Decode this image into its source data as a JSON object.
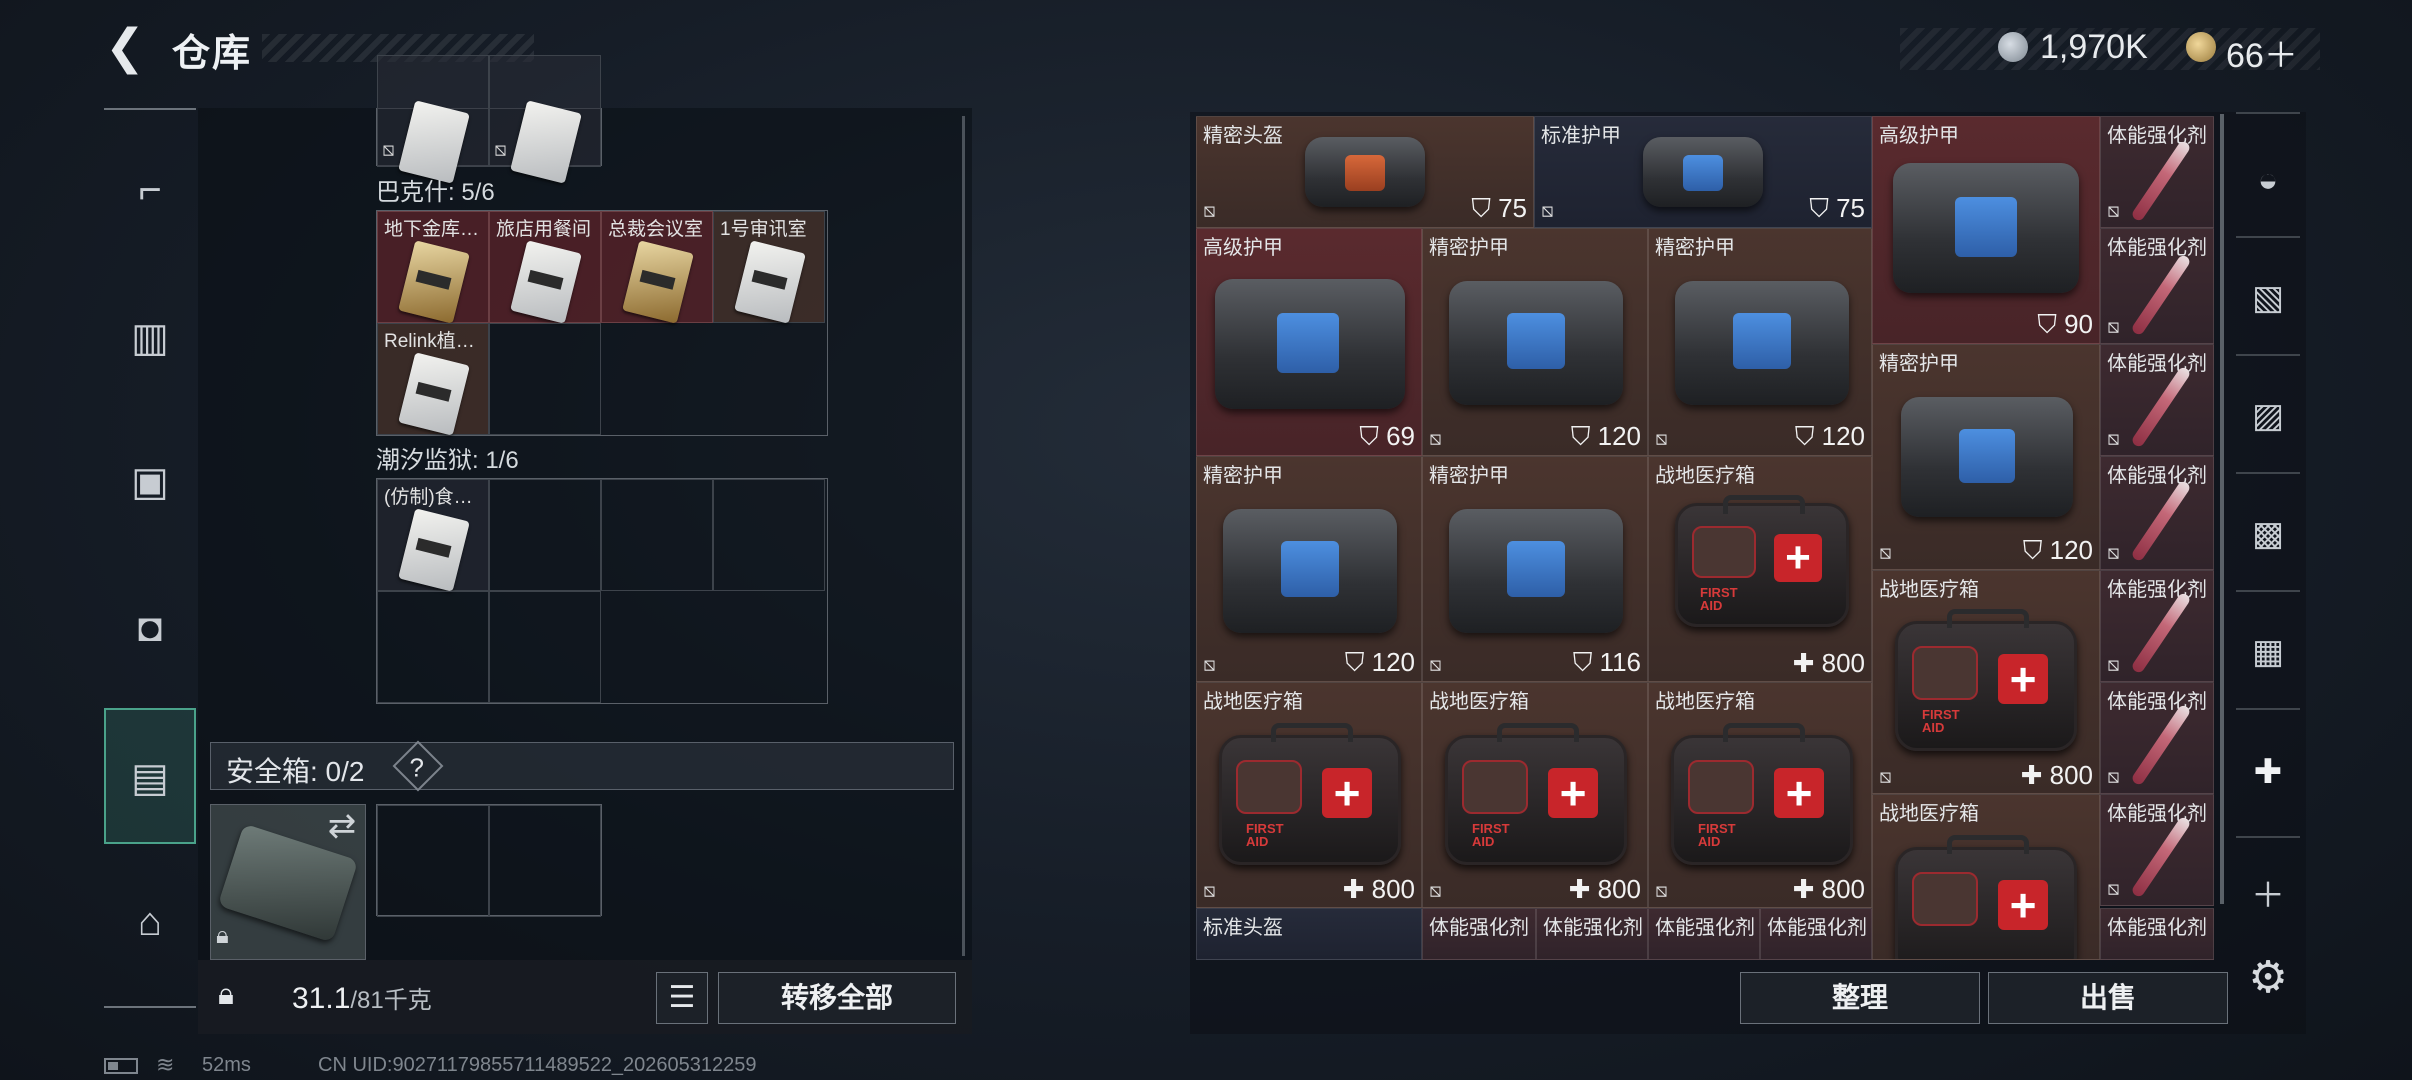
{
  "header": {
    "back_label": "<",
    "title": "仓库",
    "currency1": "1,970K",
    "currency2": "66＋"
  },
  "sidebar_categories": [
    {
      "icon": "pistol-icon"
    },
    {
      "icon": "vest-icon"
    },
    {
      "icon": "backpack-icon"
    },
    {
      "icon": "bag-icon"
    },
    {
      "icon": "safe-case-icon",
      "selected": true
    },
    {
      "icon": "toolbox-icon"
    }
  ],
  "storage": {
    "group1_label": "巴克什: 5/6",
    "group1_items": [
      "地下金库…",
      "旅店用餐间",
      "总裁会议室",
      "1号审讯室",
      "Relink植…"
    ],
    "group2_label": "潮汐监狱: 1/6",
    "group2_items": [
      "(仿制)食…"
    ]
  },
  "safe_box": {
    "label": "安全箱: 0/2",
    "help": "?"
  },
  "weight": {
    "current": "31.1",
    "max": "/81千克"
  },
  "buttons": {
    "list_icon": "☰",
    "transfer_all": "转移全部",
    "sort": "整理",
    "sell": "出售"
  },
  "inventory": [
    {
      "label": "精密头盔",
      "value": "75"
    },
    {
      "label": "标准护甲",
      "value": "75"
    },
    {
      "label": "高级护甲",
      "value": "90"
    },
    {
      "label": "体能强化剂"
    },
    {
      "label": "高级护甲",
      "value": "69"
    },
    {
      "label": "精密护甲",
      "value": "120"
    },
    {
      "label": "精密护甲",
      "value": "120"
    },
    {
      "label": "体能强化剂"
    },
    {
      "label": "精密护甲",
      "value": "120"
    },
    {
      "label": "体能强化剂"
    },
    {
      "label": "精密护甲",
      "value": "120"
    },
    {
      "label": "精密护甲",
      "value": "116"
    },
    {
      "label": "战地医疗箱",
      "value": "800"
    },
    {
      "label": "体能强化剂"
    },
    {
      "label": "战地医疗箱",
      "value": "800"
    },
    {
      "label": "体能强化剂"
    },
    {
      "label": "战地医疗箱",
      "value": "800"
    },
    {
      "label": "战地医疗箱",
      "value": "800"
    },
    {
      "label": "战地医疗箱",
      "value": "800"
    },
    {
      "label": "体能强化剂"
    },
    {
      "label": "战地医疗箱"
    },
    {
      "label": "体能强化剂"
    },
    {
      "label": "标准头盔"
    },
    {
      "label": "体能强化剂"
    },
    {
      "label": "体能强化剂"
    },
    {
      "label": "体能强化剂"
    },
    {
      "label": "体能强化剂"
    },
    {
      "label": "体能强化剂"
    }
  ],
  "status": {
    "ping": "52ms",
    "uid": "CN UID:9027117985571148952​2_202605312259"
  },
  "colors": {
    "accent_green": "#4aa28a",
    "cell_red": "#5a2a2e",
    "cell_brown": "#4b352e",
    "armor_blue": "#4d8fe0",
    "medkit_red": "#c8252a"
  }
}
